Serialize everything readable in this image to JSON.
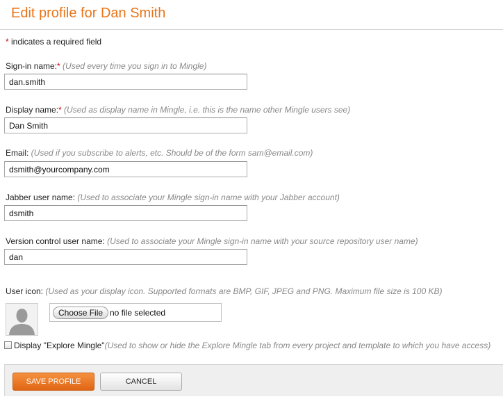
{
  "page": {
    "title": "Edit profile for Dan Smith"
  },
  "required_note": {
    "star": "*",
    "text": " indicates a required field"
  },
  "fields": {
    "signin": {
      "label": "Sign-in name:",
      "star": "*",
      "hint": " (Used every time you sign in to Mingle)",
      "value": "dan.smith"
    },
    "display": {
      "label": "Display name:",
      "star": "*",
      "hint": " (Used as display name in Mingle, i.e. this is the name other Mingle users see)",
      "value": "Dan Smith"
    },
    "email": {
      "label": "Email:",
      "hint": " (Used if you subscribe to alerts, etc. Should be of the form sam@email.com)",
      "value": "dsmith@yourcompany.com"
    },
    "jabber": {
      "label": "Jabber user name:",
      "hint": " (Used to associate your Mingle sign-in name with your Jabber account)",
      "value": "dsmith"
    },
    "vcs": {
      "label": "Version control user name:",
      "hint": " (Used to associate your Mingle sign-in name with your source repository user name)",
      "value": "dan"
    },
    "icon": {
      "label": "User icon:",
      "hint": " (Used as your display icon. Supported formats are BMP, GIF, JPEG and PNG. Maximum file size is 100 KB)",
      "choose_label": "Choose File",
      "file_status": "no file selected",
      "avatar_icon": "default-user-silhouette"
    }
  },
  "explore": {
    "label": "Display \"Explore Mingle\"",
    "hint": "(Used to show or hide the Explore Mingle tab from every project and template to which you have access)",
    "checked": false
  },
  "buttons": {
    "save_label": "SAVE PROFILE",
    "cancel_label": "CANCEL"
  },
  "colors": {
    "accent": "#e8751a",
    "required": "#cc0000",
    "hint": "#888888",
    "bar": "#efefef"
  }
}
